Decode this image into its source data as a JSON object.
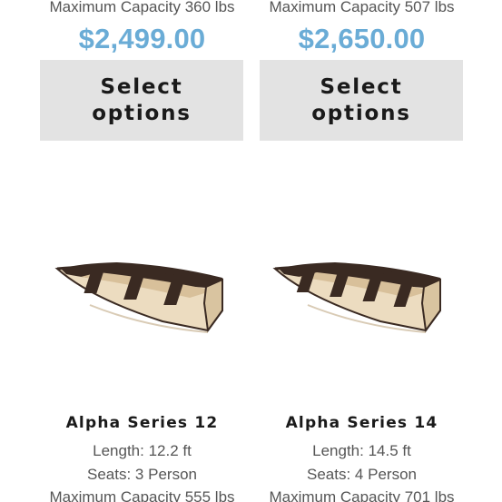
{
  "products_top": [
    {
      "capacity": "Maximum Capacity 360 lbs",
      "price": "$2,499.00",
      "button_label": "Select options"
    },
    {
      "capacity": "Maximum Capacity 507 lbs",
      "price": "$2,650.00",
      "button_label": "Select options"
    }
  ],
  "products_bottom": [
    {
      "title": "Alpha Series 12",
      "length": "Length: 12.2 ft",
      "seats": "Seats: 3 Person",
      "capacity": "Maximum Capacity 555 lbs",
      "image": "folding-boat-image"
    },
    {
      "title": "Alpha Series 14",
      "length": "Length: 14.5 ft",
      "seats": "Seats: 4 Person",
      "capacity": "Maximum Capacity 701 lbs",
      "image": "folding-boat-image"
    }
  ],
  "colors": {
    "price": "#6aacd6",
    "button_bg": "#e3e3e3",
    "hull_outer": "#ecdcc0",
    "hull_inner": "#3a2a22"
  }
}
